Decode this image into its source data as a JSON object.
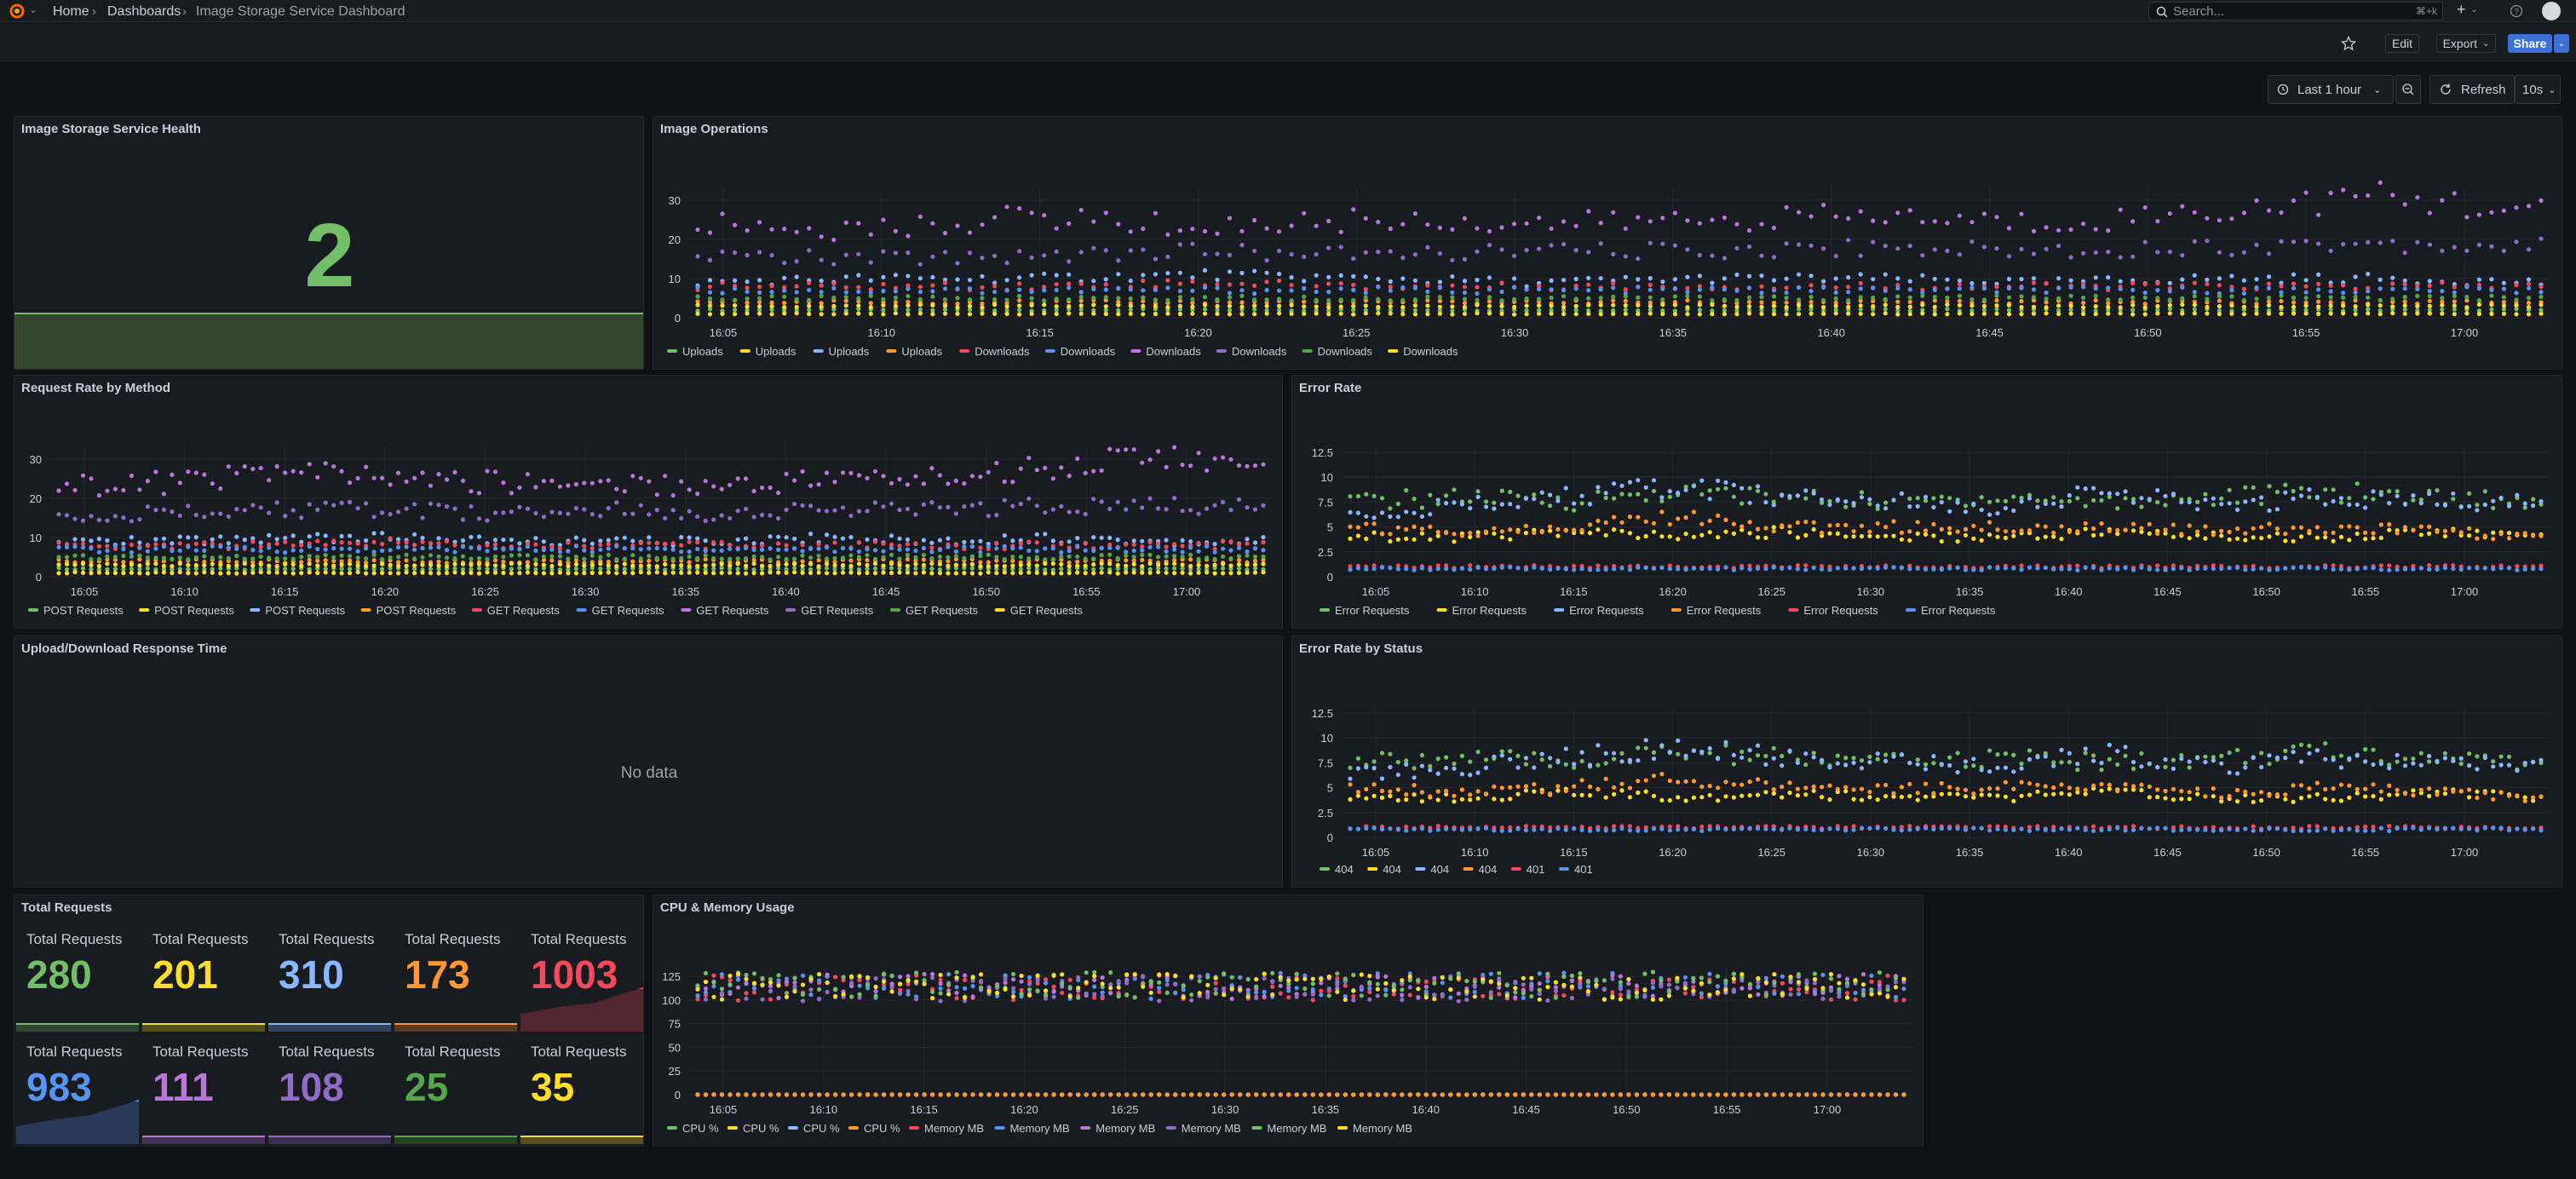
{
  "header": {
    "breadcrumbs": [
      "Home",
      "Dashboards",
      "Image Storage Service Dashboard"
    ],
    "search_placeholder": "Search...",
    "search_shortcut": "⌘+k",
    "edit_label": "Edit",
    "export_label": "Export",
    "share_label": "Share"
  },
  "time_controls": {
    "range_label": "Last 1 hour",
    "refresh_label": "Refresh",
    "refresh_interval": "10s"
  },
  "colors": {
    "green": "#73bf69",
    "yellow": "#fade2a",
    "blue": "#8ab8ff",
    "orange": "#ff9830",
    "red": "#f2495c",
    "blue2": "#5794f2",
    "purple": "#b877d9",
    "purple2": "#a48cd5",
    "darkgreen": "#56a64b",
    "gold": "#f2cc0c"
  },
  "panels": {
    "health": {
      "title": "Image Storage Service Health",
      "value": "2"
    },
    "image_ops": {
      "title": "Image Operations"
    },
    "request_rate": {
      "title": "Request Rate by Method"
    },
    "error_rate": {
      "title": "Error Rate"
    },
    "response_time": {
      "title": "Upload/Download Response Time",
      "no_data": "No data"
    },
    "error_status": {
      "title": "Error Rate by Status"
    },
    "total_requests": {
      "title": "Total Requests",
      "stats": [
        {
          "label": "Total Requests",
          "value": "280",
          "color": "#73bf69"
        },
        {
          "label": "Total Requests",
          "value": "201",
          "color": "#fade2a"
        },
        {
          "label": "Total Requests",
          "value": "310",
          "color": "#8ab8ff"
        },
        {
          "label": "Total Requests",
          "value": "173",
          "color": "#ff9830"
        },
        {
          "label": "Total Requests",
          "value": "1003",
          "color": "#f2495c"
        },
        {
          "label": "Total Requests",
          "value": "983",
          "color": "#5794f2"
        },
        {
          "label": "Total Requests",
          "value": "111",
          "color": "#b877d9"
        },
        {
          "label": "Total Requests",
          "value": "108",
          "color": "#8f6dc7"
        },
        {
          "label": "Total Requests",
          "value": "25",
          "color": "#56a64b"
        },
        {
          "label": "Total Requests",
          "value": "35",
          "color": "#fade2a"
        }
      ]
    },
    "cpu_mem": {
      "title": "CPU & Memory Usage"
    }
  },
  "chart_data": [
    {
      "type": "scatter",
      "panel": "image_ops",
      "x_ticks": [
        "16:05",
        "16:10",
        "16:15",
        "16:20",
        "16:25",
        "16:30",
        "16:35",
        "16:40",
        "16:45",
        "16:50",
        "16:55",
        "17:00"
      ],
      "y_ticks": [
        "0",
        "10",
        "20",
        "30"
      ],
      "ylim": [
        0,
        33
      ],
      "series": [
        {
          "name": "Uploads",
          "color": "#73bf69",
          "values": [
            2,
            2,
            2,
            2,
            2,
            2,
            2,
            2,
            2,
            2,
            2,
            2
          ]
        },
        {
          "name": "Uploads",
          "color": "#fade2a",
          "values": [
            1,
            1,
            1,
            1,
            1,
            1,
            1,
            1,
            1,
            1,
            1,
            1
          ]
        },
        {
          "name": "Uploads",
          "color": "#8ab8ff",
          "values": [
            9,
            10,
            10,
            11,
            10,
            9,
            10,
            10,
            9,
            10,
            10,
            9
          ]
        },
        {
          "name": "Uploads",
          "color": "#ff9830",
          "values": [
            4,
            4,
            4,
            4,
            4,
            4,
            4,
            4,
            4,
            4,
            4,
            4
          ]
        },
        {
          "name": "Downloads",
          "color": "#f2495c",
          "values": [
            8,
            8,
            8,
            9,
            8,
            8,
            8,
            8,
            8,
            8,
            8,
            8
          ]
        },
        {
          "name": "Downloads",
          "color": "#5794f2",
          "values": [
            7,
            7,
            7,
            7,
            7,
            7,
            7,
            7,
            7,
            7,
            7,
            7
          ]
        },
        {
          "name": "Downloads",
          "color": "#b877d9",
          "values": [
            24,
            22,
            26,
            23,
            25,
            24,
            25,
            26,
            24,
            27,
            31,
            27
          ]
        },
        {
          "name": "Downloads",
          "color": "#8f6dc7",
          "values": [
            16,
            15,
            16,
            17,
            16,
            17,
            17,
            18,
            17,
            18,
            19,
            18
          ]
        },
        {
          "name": "Downloads",
          "color": "#56a64b",
          "values": [
            5,
            5,
            5,
            5,
            5,
            5,
            5,
            5,
            5,
            5,
            5,
            5
          ]
        },
        {
          "name": "Downloads",
          "color": "#fade2a",
          "values": [
            3,
            3,
            3,
            3,
            3,
            3,
            3,
            3,
            3,
            3,
            3,
            3
          ]
        }
      ]
    },
    {
      "type": "scatter",
      "panel": "request_rate",
      "x_ticks": [
        "16:05",
        "16:10",
        "16:15",
        "16:20",
        "16:25",
        "16:30",
        "16:35",
        "16:40",
        "16:45",
        "16:50",
        "16:55",
        "17:00"
      ],
      "y_ticks": [
        "0",
        "10",
        "20",
        "30"
      ],
      "ylim": [
        0,
        33
      ],
      "series": [
        {
          "name": "POST Requests",
          "color": "#73bf69",
          "values": [
            2,
            2,
            2,
            2,
            2,
            2,
            2,
            2,
            2,
            2,
            2,
            2
          ]
        },
        {
          "name": "POST Requests",
          "color": "#fade2a",
          "values": [
            1,
            1,
            1,
            1,
            1,
            1,
            1,
            1,
            1,
            1,
            1,
            1
          ]
        },
        {
          "name": "POST Requests",
          "color": "#8ab8ff",
          "values": [
            9,
            9,
            10,
            10,
            9,
            9,
            9,
            10,
            9,
            10,
            9,
            9
          ]
        },
        {
          "name": "POST Requests",
          "color": "#ff9830",
          "values": [
            4,
            4,
            4,
            4,
            4,
            4,
            4,
            4,
            4,
            4,
            4,
            4
          ]
        },
        {
          "name": "GET Requests",
          "color": "#f2495c",
          "values": [
            8,
            8,
            8,
            9,
            8,
            8,
            8,
            8,
            8,
            8,
            8,
            8
          ]
        },
        {
          "name": "GET Requests",
          "color": "#5794f2",
          "values": [
            7,
            7,
            7,
            7,
            7,
            7,
            7,
            7,
            7,
            7,
            7,
            7
          ]
        },
        {
          "name": "GET Requests",
          "color": "#b877d9",
          "values": [
            23,
            24,
            27,
            25,
            24,
            24,
            23,
            25,
            25,
            28,
            31,
            27
          ]
        },
        {
          "name": "GET Requests",
          "color": "#8f6dc7",
          "values": [
            16,
            16,
            17,
            17,
            16,
            17,
            16,
            17,
            17,
            18,
            18,
            18
          ]
        },
        {
          "name": "GET Requests",
          "color": "#56a64b",
          "values": [
            5,
            5,
            5,
            5,
            5,
            5,
            5,
            5,
            5,
            5,
            5,
            5
          ]
        },
        {
          "name": "GET Requests",
          "color": "#fade2a",
          "values": [
            3,
            3,
            3,
            3,
            3,
            3,
            3,
            3,
            3,
            3,
            3,
            3
          ]
        }
      ]
    },
    {
      "type": "scatter",
      "panel": "error_rate",
      "x_ticks": [
        "16:05",
        "16:10",
        "16:15",
        "16:20",
        "16:25",
        "16:30",
        "16:35",
        "16:40",
        "16:45",
        "16:50",
        "16:55",
        "17:00"
      ],
      "y_ticks": [
        "0",
        "2.5",
        "5",
        "7.5",
        "10",
        "12.5"
      ],
      "ylim": [
        0,
        13
      ],
      "series": [
        {
          "name": "Error Requests",
          "color": "#73bf69",
          "values": [
            7.5,
            8,
            7.5,
            8.5,
            8,
            7.5,
            8,
            7.5,
            8,
            8.5,
            8,
            7.5
          ]
        },
        {
          "name": "Error Requests",
          "color": "#fade2a",
          "values": [
            4,
            4,
            4.5,
            4,
            4.5,
            4,
            4,
            4.5,
            4,
            4,
            4.5,
            4
          ]
        },
        {
          "name": "Error Requests",
          "color": "#8ab8ff",
          "values": [
            6.5,
            7,
            8,
            9,
            8,
            7.5,
            7,
            8.5,
            7,
            8,
            7.5,
            7.5
          ]
        },
        {
          "name": "Error Requests",
          "color": "#ff9830",
          "values": [
            5,
            4.5,
            5,
            6,
            5,
            5,
            5,
            5,
            4.5,
            5,
            4.5,
            4
          ]
        },
        {
          "name": "Error Requests",
          "color": "#f2495c",
          "values": [
            1,
            1,
            1,
            1,
            1,
            1,
            1,
            1,
            1,
            1,
            1,
            1
          ]
        },
        {
          "name": "Error Requests",
          "color": "#5794f2",
          "values": [
            0.8,
            0.8,
            0.8,
            0.8,
            0.8,
            0.8,
            0.8,
            0.8,
            0.8,
            0.8,
            0.8,
            0.8
          ]
        }
      ]
    },
    {
      "type": "scatter",
      "panel": "error_status",
      "x_ticks": [
        "16:05",
        "16:10",
        "16:15",
        "16:20",
        "16:25",
        "16:30",
        "16:35",
        "16:40",
        "16:45",
        "16:50",
        "16:55",
        "17:00"
      ],
      "y_ticks": [
        "0",
        "2.5",
        "5",
        "7.5",
        "10",
        "12.5"
      ],
      "ylim": [
        0,
        13
      ],
      "series": [
        {
          "name": "404",
          "color": "#73bf69",
          "values": [
            7.5,
            8,
            7.5,
            8.5,
            8,
            7.5,
            8,
            7.5,
            8,
            8.5,
            8,
            7.5
          ]
        },
        {
          "name": "404",
          "color": "#fade2a",
          "values": [
            4,
            4,
            4.5,
            4,
            4.5,
            4,
            4,
            4.5,
            4,
            4,
            4.5,
            4
          ]
        },
        {
          "name": "404",
          "color": "#8ab8ff",
          "values": [
            6.5,
            7,
            8,
            9,
            8,
            7.5,
            7,
            8.5,
            7,
            8,
            7.5,
            7.5
          ]
        },
        {
          "name": "404",
          "color": "#ff9830",
          "values": [
            5,
            4.5,
            5,
            6,
            5,
            5,
            5,
            5,
            4.5,
            5,
            4.5,
            4
          ]
        },
        {
          "name": "401",
          "color": "#f2495c",
          "values": [
            1,
            1,
            1,
            1,
            1,
            1,
            1,
            1,
            1,
            1,
            1,
            1
          ]
        },
        {
          "name": "401",
          "color": "#5794f2",
          "values": [
            0.8,
            0.8,
            0.8,
            0.8,
            0.8,
            0.8,
            0.8,
            0.8,
            0.8,
            0.8,
            0.8,
            0.8
          ]
        }
      ]
    },
    {
      "type": "scatter",
      "panel": "cpu_mem",
      "x_ticks": [
        "16:05",
        "16:10",
        "16:15",
        "16:20",
        "16:25",
        "16:30",
        "16:35",
        "16:40",
        "16:45",
        "16:50",
        "16:55",
        "17:00"
      ],
      "y_ticks": [
        "0",
        "25",
        "50",
        "75",
        "100",
        "125"
      ],
      "ylim": [
        0,
        135
      ],
      "series": [
        {
          "name": "CPU %",
          "color": "#73bf69",
          "values": [
            0,
            0,
            0,
            0,
            0,
            0,
            0,
            0,
            0,
            0,
            0,
            0
          ]
        },
        {
          "name": "CPU %",
          "color": "#fade2a",
          "values": [
            0,
            0,
            0,
            0,
            0,
            0,
            0,
            0,
            0,
            0,
            0,
            0
          ]
        },
        {
          "name": "CPU %",
          "color": "#8ab8ff",
          "values": [
            0,
            0,
            0,
            0,
            0,
            0,
            0,
            0,
            0,
            0,
            0,
            0
          ]
        },
        {
          "name": "CPU %",
          "color": "#ff9830",
          "values": [
            0,
            0,
            0,
            0,
            0,
            0,
            0,
            0,
            0,
            0,
            0,
            0
          ]
        },
        {
          "name": "Memory MB",
          "color": "#f2495c",
          "values": [
            113,
            113,
            113,
            113,
            113,
            113,
            113,
            113,
            113,
            113,
            113,
            113
          ]
        },
        {
          "name": "Memory MB",
          "color": "#5794f2",
          "values": [
            115,
            115,
            115,
            115,
            115,
            115,
            115,
            115,
            115,
            115,
            115,
            115
          ]
        },
        {
          "name": "Memory MB",
          "color": "#b877d9",
          "values": [
            114,
            114,
            114,
            114,
            114,
            114,
            114,
            114,
            114,
            114,
            114,
            114
          ]
        },
        {
          "name": "Memory MB",
          "color": "#8f6dc7",
          "values": [
            112,
            112,
            112,
            112,
            112,
            112,
            112,
            112,
            112,
            112,
            112,
            112
          ]
        },
        {
          "name": "Memory MB",
          "color": "#73bf69",
          "values": [
            116,
            116,
            116,
            116,
            116,
            116,
            116,
            116,
            116,
            116,
            116,
            116
          ]
        },
        {
          "name": "Memory MB",
          "color": "#fade2a",
          "values": [
            114,
            114,
            114,
            114,
            114,
            114,
            114,
            114,
            114,
            114,
            114,
            114
          ]
        }
      ]
    }
  ]
}
